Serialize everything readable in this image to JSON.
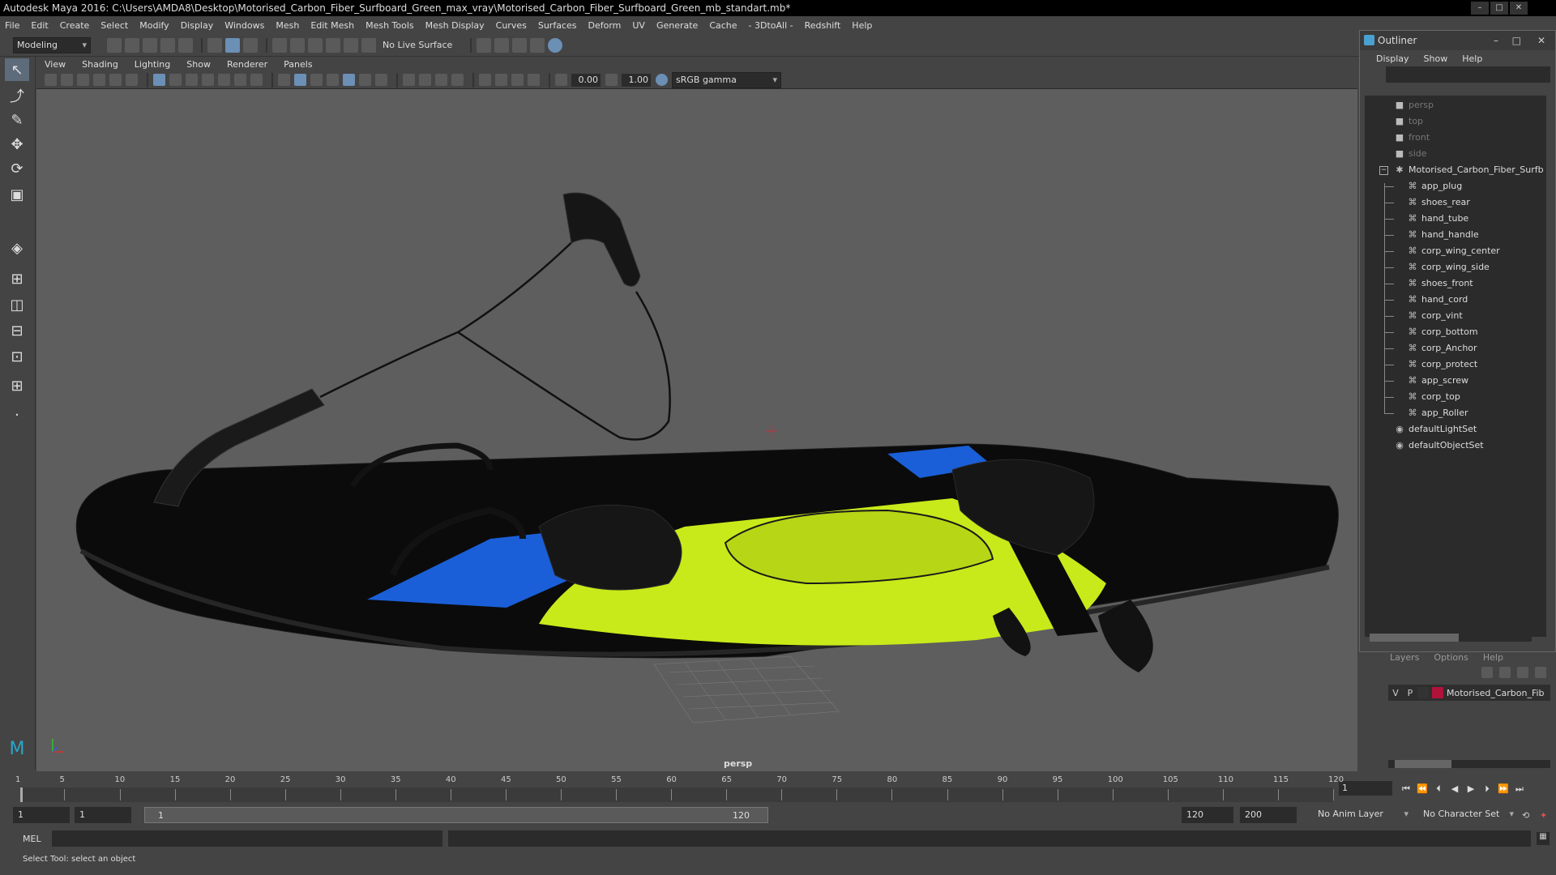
{
  "window": {
    "title": "Autodesk Maya 2016: C:\\Users\\AMDA8\\Desktop\\Motorised_Carbon_Fiber_Surfboard_Green_max_vray\\Motorised_Carbon_Fiber_Surfboard_Green_mb_standart.mb*"
  },
  "menubar": [
    "File",
    "Edit",
    "Create",
    "Select",
    "Modify",
    "Display",
    "Windows",
    "Mesh",
    "Edit Mesh",
    "Mesh Tools",
    "Mesh Display",
    "Curves",
    "Surfaces",
    "Deform",
    "UV",
    "Generate",
    "Cache",
    "- 3DtoAll -",
    "Redshift",
    "Help"
  ],
  "shelf": {
    "mode": "Modeling",
    "live_surface": "No Live Surface"
  },
  "panel_menu": [
    "View",
    "Shading",
    "Lighting",
    "Show",
    "Renderer",
    "Panels"
  ],
  "panel_toolbar": {
    "exposure": "0.00",
    "gamma": "1.00",
    "colorspace": "sRGB gamma"
  },
  "viewport": {
    "camera_label": "persp"
  },
  "outliner": {
    "title": "Outliner",
    "menu": [
      "Display",
      "Show",
      "Help"
    ],
    "cameras": [
      "persp",
      "top",
      "front",
      "side"
    ],
    "root": "Motorised_Carbon_Fiber_Surfb",
    "children": [
      "app_plug",
      "shoes_rear",
      "hand_tube",
      "hand_handle",
      "corp_wing_center",
      "corp_wing_side",
      "shoes_front",
      "hand_cord",
      "corp_vint",
      "corp_bottom",
      "corp_Anchor",
      "corp_protect",
      "app_screw",
      "corp_top",
      "app_Roller"
    ],
    "sets": [
      "defaultLightSet",
      "defaultObjectSet"
    ]
  },
  "layers": {
    "menu": [
      "Layers",
      "Options",
      "Help"
    ],
    "row": {
      "v": "V",
      "p": "P",
      "name": "Motorised_Carbon_Fib",
      "color": "#b0123a"
    }
  },
  "timeline": {
    "ticks": [
      "1",
      "5",
      "10",
      "15",
      "20",
      "25",
      "30",
      "35",
      "40",
      "45",
      "50",
      "55",
      "60",
      "65",
      "70",
      "75",
      "80",
      "85",
      "90",
      "95",
      "100",
      "105",
      "110",
      "115",
      "120"
    ],
    "current_frame": "1"
  },
  "range": {
    "start": "1",
    "playback_start": "1",
    "range_start_label": "1",
    "range_end_label": "120",
    "playback_end": "120",
    "end": "200",
    "anim_layer": "No Anim Layer",
    "character_set": "No Character Set"
  },
  "command": {
    "label": "MEL"
  },
  "help_line": "Select Tool: select an object",
  "colors": {
    "board_yellow": "#c8ea1a",
    "board_blue": "#1a5fd8",
    "bg_viewport": "#5e5e5e"
  }
}
